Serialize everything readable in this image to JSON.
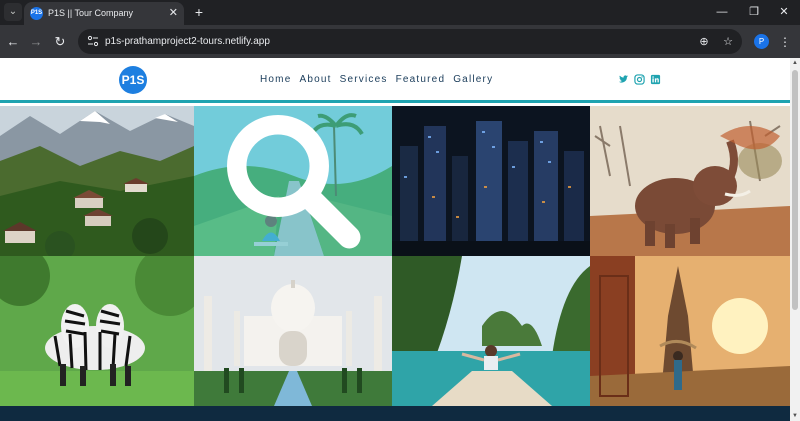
{
  "browser": {
    "tab_title": "P1S || Tour Company",
    "favicon_text": "P1S",
    "url": "p1s-prathamproject2-tours.netlify.app",
    "profile_initial": "P",
    "new_tab_label": "+",
    "close_tab_label": "✕"
  },
  "site": {
    "logo_text": "P1S",
    "nav": [
      {
        "label": "Home"
      },
      {
        "label": "About"
      },
      {
        "label": "Services"
      },
      {
        "label": "Featured"
      },
      {
        "label": "Gallery"
      }
    ],
    "socials": [
      "twitter-icon",
      "instagram-icon",
      "linkedin-icon"
    ],
    "accent_color": "#1fa3b0",
    "footer_color": "#0f2a40"
  },
  "gallery": {
    "tiles": [
      {
        "subject": "mountain-village",
        "hovered": false
      },
      {
        "subject": "woman-on-road-palm-trees",
        "hovered": true
      },
      {
        "subject": "city-at-night",
        "hovered": false
      },
      {
        "subject": "elephant-savanna",
        "hovered": false
      },
      {
        "subject": "zebras",
        "hovered": false
      },
      {
        "subject": "taj-mahal",
        "hovered": false
      },
      {
        "subject": "boat-lagoon",
        "hovered": false
      },
      {
        "subject": "temple-sunset",
        "hovered": false
      }
    ]
  }
}
